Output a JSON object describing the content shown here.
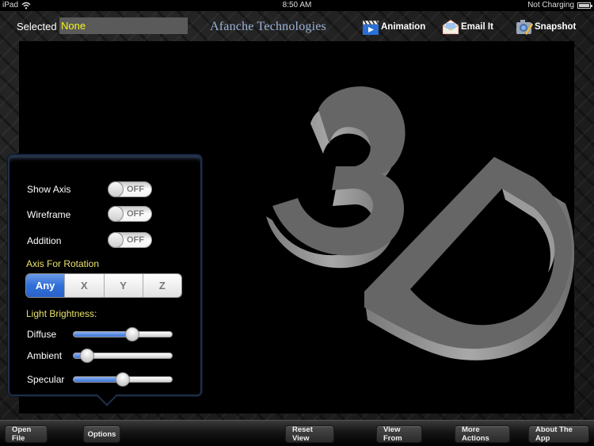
{
  "status_bar": {
    "device": "iPad",
    "time": "8:50 AM",
    "battery_status": "Not Charging",
    "icons": [
      "wifi-icon",
      "battery-icon"
    ]
  },
  "header": {
    "selected_label": "Selected",
    "selected_value": "None",
    "brand": "Afanche Technologies",
    "buttons": [
      {
        "label": "Animation",
        "icon": "clapperboard-icon"
      },
      {
        "label": "Email It",
        "icon": "envelope-icon"
      },
      {
        "label": "Snapshot",
        "icon": "camera-icon"
      }
    ]
  },
  "viewport": {
    "model_text": "3D",
    "background": "#000000",
    "model_color": "#6a6a6a"
  },
  "options_popover": {
    "toggles": [
      {
        "label": "Show Axis",
        "state": "OFF"
      },
      {
        "label": "Wireframe",
        "state": "OFF"
      },
      {
        "label": "Addition",
        "state": "OFF"
      }
    ],
    "axis_section_label": "Axis For Rotation",
    "axis_options": [
      "Any",
      "X",
      "Y",
      "Z"
    ],
    "axis_selected": "Any",
    "light_section_label": "Light Brightness:",
    "sliders": [
      {
        "label": "Diffuse",
        "value": 0.6
      },
      {
        "label": "Ambient",
        "value": 0.14
      },
      {
        "label": "Specular",
        "value": 0.5
      }
    ]
  },
  "toolbar": {
    "buttons": [
      "Open File",
      "Options",
      "Reset View",
      "View From",
      "More Actions",
      "About The App"
    ]
  },
  "colors": {
    "accent_blue": "#2f6fd8",
    "section_yellow": "#e9e26a",
    "selected_value_yellow": "#f5f520",
    "brand_blue": "#9bb3d9"
  }
}
